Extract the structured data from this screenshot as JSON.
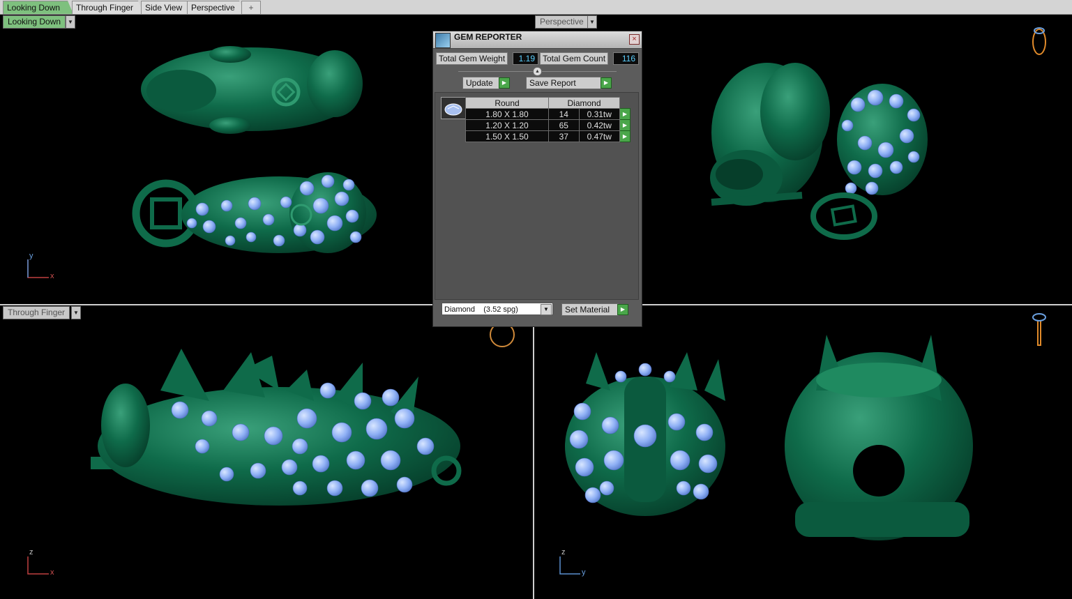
{
  "tabs": [
    {
      "label": "Looking Down",
      "active": true
    },
    {
      "label": "Through Finger",
      "active": false
    },
    {
      "label": "Side View",
      "active": false
    },
    {
      "label": "Perspective",
      "active": false
    }
  ],
  "tab_add_label": "+",
  "viewports": {
    "top_left": {
      "label": "Looking Down",
      "axis_v": "y",
      "axis_h": "x"
    },
    "top_right": {
      "label": "Perspective"
    },
    "bottom_left": {
      "label": "Through Finger",
      "axis_v": "z",
      "axis_h": "x"
    },
    "bottom_right": {
      "axis_v": "z",
      "axis_h": "y"
    }
  },
  "gem_reporter": {
    "title": "GEM REPORTER",
    "close_icon": "×",
    "total_weight_label": "Total Gem Weight",
    "total_weight_value": "1.19",
    "total_count_label": "Total Gem Count",
    "total_count_value": "116",
    "update_label": "Update",
    "save_report_label": "Save Report",
    "table": {
      "col_shape": "Round",
      "col_material": "Diamond",
      "rows": [
        {
          "size": "1.80 X 1.80",
          "count": "14",
          "weight": "0.31tw"
        },
        {
          "size": "1.20 X 1.20",
          "count": "65",
          "weight": "0.42tw"
        },
        {
          "size": "1.50 X 1.50",
          "count": "37",
          "weight": "0.47tw"
        }
      ]
    },
    "material_select": "Diamond    (3.52 spg)",
    "set_material_label": "Set Material"
  },
  "colors": {
    "jade": "#0f6b4a",
    "gem": "#8fb0f5",
    "accent": "#7ec07e"
  }
}
